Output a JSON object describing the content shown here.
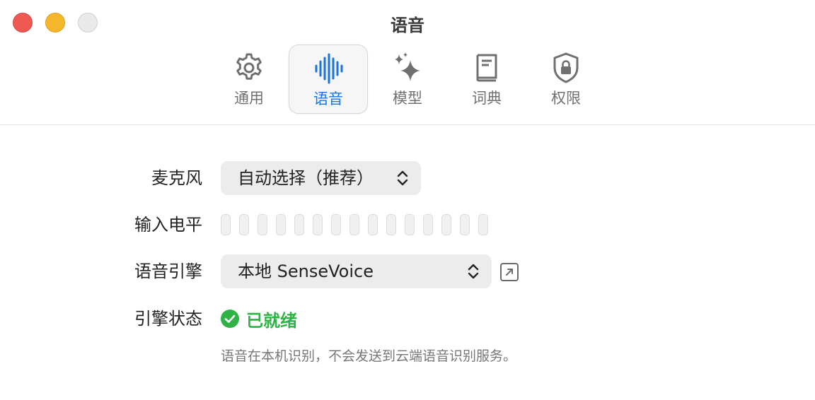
{
  "window": {
    "title": "语音"
  },
  "tabs": [
    {
      "label": "通用",
      "icon": "gear-icon"
    },
    {
      "label": "语音",
      "icon": "waveform-icon",
      "active": true
    },
    {
      "label": "模型",
      "icon": "sparkles-icon"
    },
    {
      "label": "词典",
      "icon": "book-icon"
    },
    {
      "label": "权限",
      "icon": "lock-shield-icon"
    }
  ],
  "settings": {
    "microphone": {
      "label": "麦克风",
      "value": "自动选择（推荐）"
    },
    "input_level": {
      "label": "输入电平",
      "level": 0
    },
    "engine": {
      "label": "语音引擎",
      "value": "本地 SenseVoice"
    },
    "engine_status": {
      "label": "引擎状态",
      "value": "已就绪"
    },
    "note": "语音在本机识别，不会发送到云端语音识别服务。"
  },
  "colors": {
    "accent": "#1874e0",
    "ready": "#2fb344"
  }
}
